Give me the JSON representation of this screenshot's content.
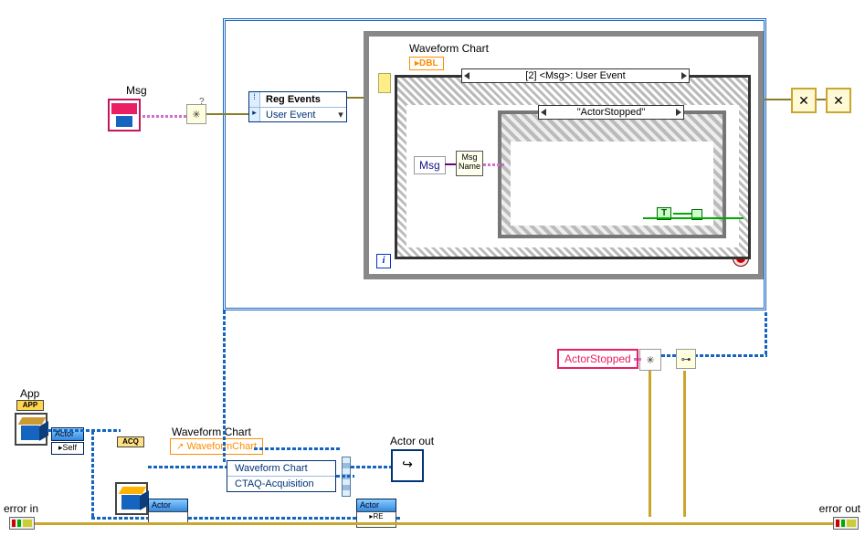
{
  "labels": {
    "msg": "Msg",
    "waveform_chart_top": "Waveform Chart",
    "dbl": "DBL",
    "reg_events": "Reg Events",
    "user_event": "User Event",
    "event_selector": "[2] <Msg>: User Event",
    "case_selector": "\"ActorStopped\"",
    "msg_inner": "Msg",
    "msg_name": "Msg\nName",
    "actor_stopped_const": "ActorStopped",
    "app": "App",
    "app_badge": "APP",
    "acq_badge": "ACQ",
    "waveform_chart_mid": "Waveform Chart",
    "waveform_chart_link": "WaveformChart",
    "method_row1": "Waveform Chart",
    "method_row2": "CTAQ-Acquisition",
    "actor_out": "Actor out",
    "error_in": "error in",
    "error_out": "error out",
    "actor_caption": "Actor",
    "self_caption": "Self",
    "true_bool": "T",
    "i": "i",
    "dyn_x": "✕"
  }
}
